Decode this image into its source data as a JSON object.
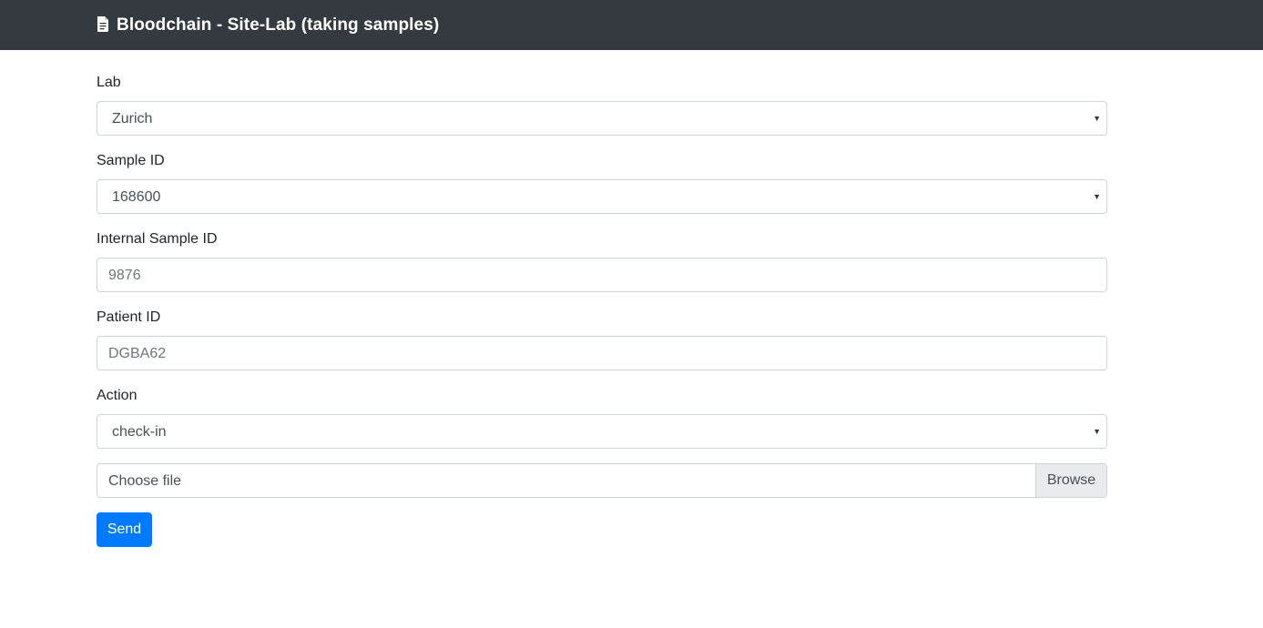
{
  "header": {
    "title": "Bloodchain - Site-Lab (taking samples)",
    "icon": "document-icon"
  },
  "form": {
    "lab": {
      "label": "Lab",
      "value": "Zurich"
    },
    "sample_id": {
      "label": "Sample ID",
      "value": "168600"
    },
    "internal_sample_id": {
      "label": "Internal Sample ID",
      "placeholder": "9876"
    },
    "patient_id": {
      "label": "Patient ID",
      "placeholder": "DGBA62"
    },
    "action": {
      "label": "Action",
      "value": "check-in"
    },
    "file": {
      "placeholder": "Choose file",
      "browse_label": "Browse"
    },
    "submit_label": "Send"
  },
  "colors": {
    "navbar": "#343a40",
    "primary": "#007bff",
    "border": "#ced4da"
  }
}
